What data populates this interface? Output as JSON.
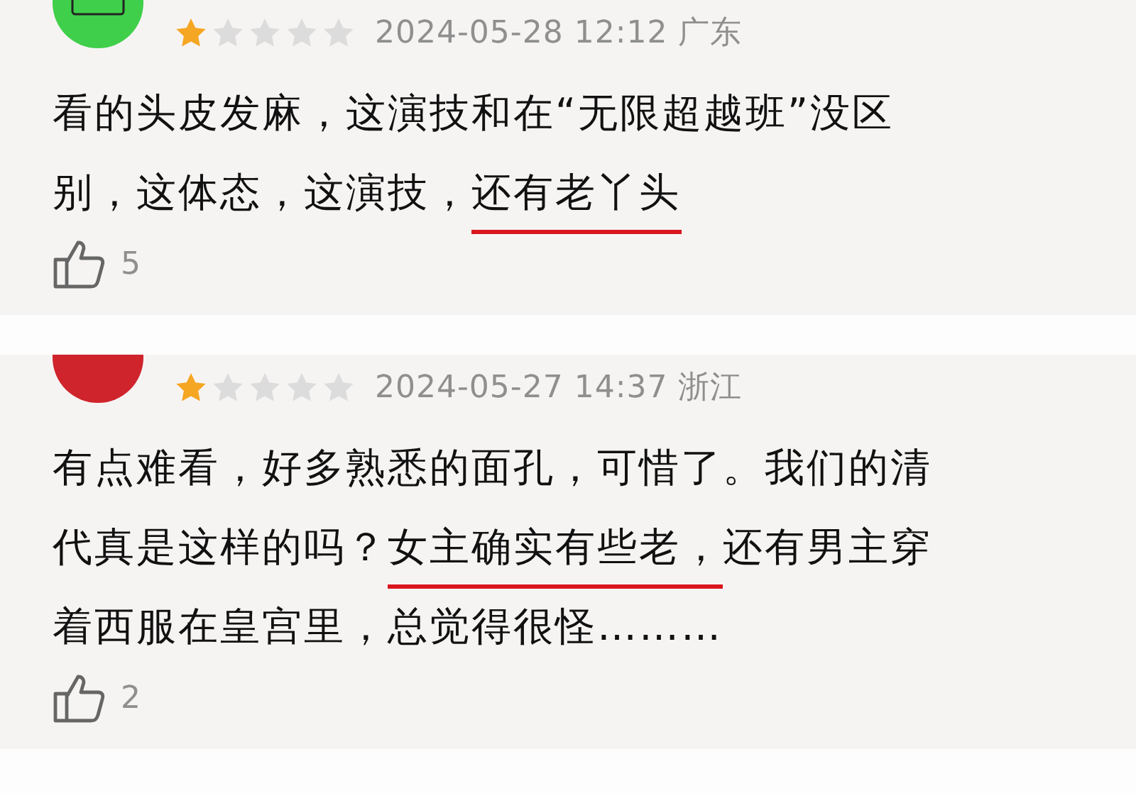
{
  "reviews": [
    {
      "stars": 1,
      "date": "2024-05-28 12:12",
      "region": "广东",
      "text": [
        {
          "text": "看的头皮发麻，这演技和在“无限超越班”没区别，这体态，这演技，",
          "underlined": false
        },
        {
          "text": "还有老丫头",
          "underlined": true
        }
      ],
      "likes": "5"
    },
    {
      "stars": 1,
      "date": "2024-05-27 14:37",
      "region": "浙江",
      "text": [
        {
          "text": "有点难看，好多熟悉的面孔，可惜了。我们的清代真是这样的吗？",
          "underlined": false
        },
        {
          "text": "女主确实有些老，",
          "underlined": true
        },
        {
          "text": "还有男主穿着西服在皇宫里，总觉得很怪………",
          "underlined": false
        }
      ],
      "likes": "2"
    }
  ]
}
